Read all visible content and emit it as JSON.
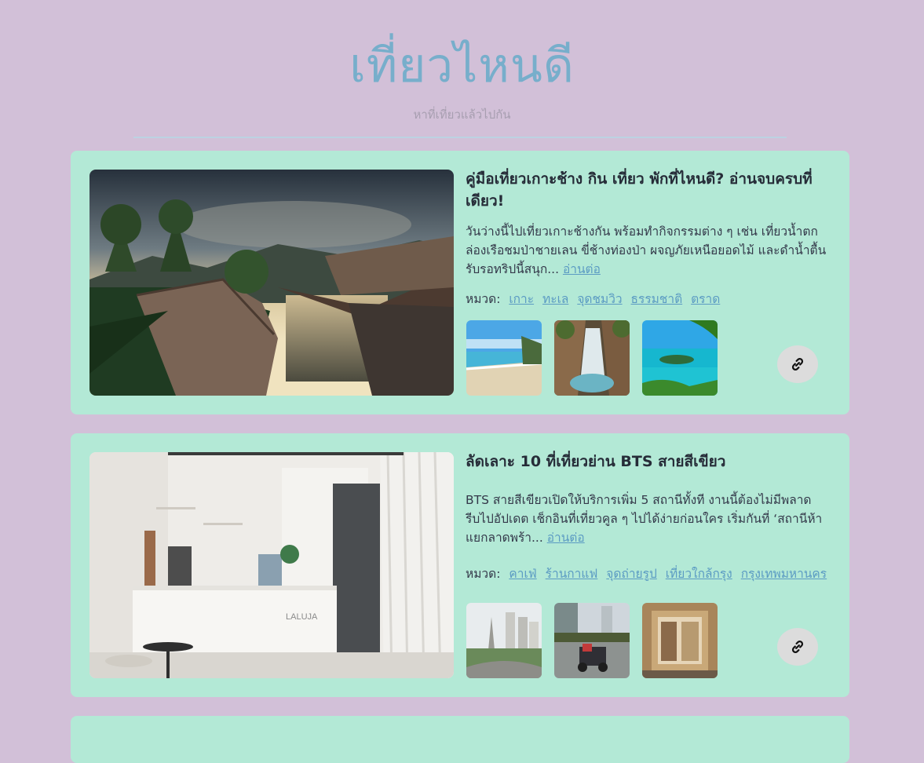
{
  "site": {
    "title": "เที่ยวไหนดี",
    "subtitle": "หาที่เที่ยวแล้วไปกัน"
  },
  "posts": [
    {
      "title": "คู่มือเที่ยวเกาะช้าง กิน เที่ยว พักที่ไหนดี? อ่านจบครบที่เดียว!",
      "description": "วันว่างนี้ไปเที่ยวเกาะช้างกัน พร้อมทำกิจกรรมต่าง ๆ เช่น เที่ยวน้ำตก ล่องเรือชมป่าชายเลน ขี่ช้างท่องป่า ผจญภัยเหนือยอดไม้ และดำน้ำตื้น รับรอทริปนี้สนุก...",
      "read_more": "อ่านต่อ",
      "category_label": "หมวด:",
      "categories": [
        "เกาะ",
        "ทะเล",
        "จุดชมวิว",
        "ธรรมชาติ",
        "ตราด"
      ],
      "hero_icon": "resort-pool-photo",
      "thumbnails": [
        "beach-photo",
        "waterfall-photo",
        "island-sea-photo"
      ],
      "link_icon": "link-icon"
    },
    {
      "title": "ลัดเลาะ 10 ที่เที่ยวย่าน BTS สายสีเขียว",
      "description": "BTS สายสีเขียวเปิดให้บริการเพิ่ม 5 สถานีทั้งที งานนี้ต้องไม่มีพลาด รีบไปอัปเดต เช็กอินที่เที่ยวคูล ๆ ไปได้ง่ายก่อนใคร เริ่มกันที่ ‘สถานีห้าแยกลาดพร้า...",
      "read_more": "อ่านต่อ",
      "category_label": "หมวด:",
      "categories": [
        "คาเฟ่",
        "ร้านกาแฟ",
        "จุดถ่ายรูป",
        "เที่ยวใกล้กรุง",
        "กรุงเทพมหานคร"
      ],
      "hero_icon": "cafe-interior-photo",
      "thumbnails": [
        "city-monument-photo",
        "go-kart-photo",
        "shop-front-photo"
      ],
      "link_icon": "link-icon"
    }
  ],
  "colors": {
    "background": "#d2c0d8",
    "card": "#b3e9d6",
    "title_accent": "#77aecb",
    "link": "#5b9bc3"
  }
}
